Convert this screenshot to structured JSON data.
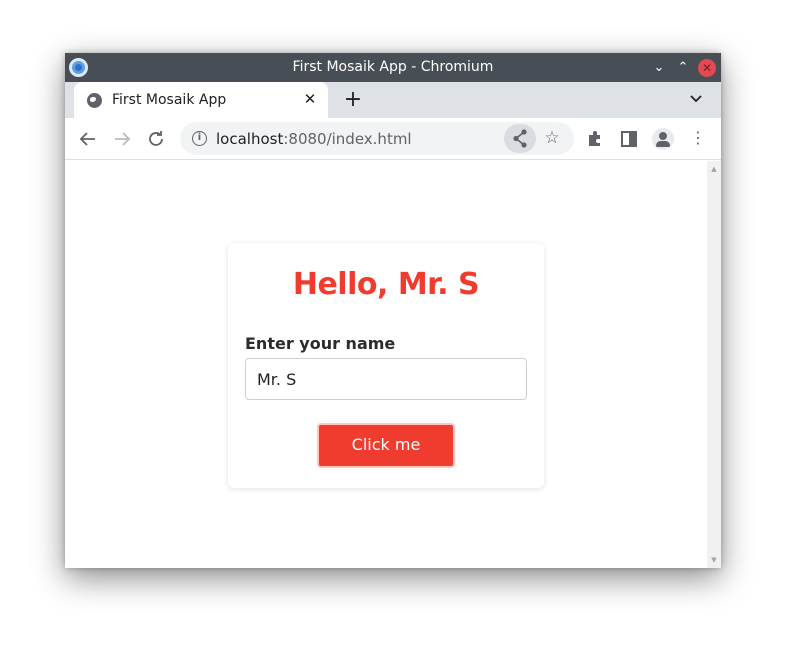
{
  "window": {
    "title": "First Mosaik App - Chromium",
    "controls": {
      "minimize": "⌄",
      "maximize": "⌃",
      "close": "✕"
    }
  },
  "tabs": [
    {
      "label": "First Mosaik App",
      "icon": "globe-icon",
      "close": "✕"
    }
  ],
  "tabstrip": {
    "new_tab": "+",
    "tab_search": "⌄"
  },
  "toolbar": {
    "back": "←",
    "forward": "→",
    "reload": "↻",
    "url_host": "localhost",
    "url_rest": ":8080/index.html",
    "bookmark": "☆",
    "menu": "⋮"
  },
  "page": {
    "heading": "Hello, Mr. S",
    "name_label": "Enter your name",
    "name_value": "Mr. S",
    "button_label": "Click me"
  },
  "colors": {
    "accent": "#f03c2f",
    "titlebar": "#474e56",
    "tabstrip": "#dee1e6"
  }
}
